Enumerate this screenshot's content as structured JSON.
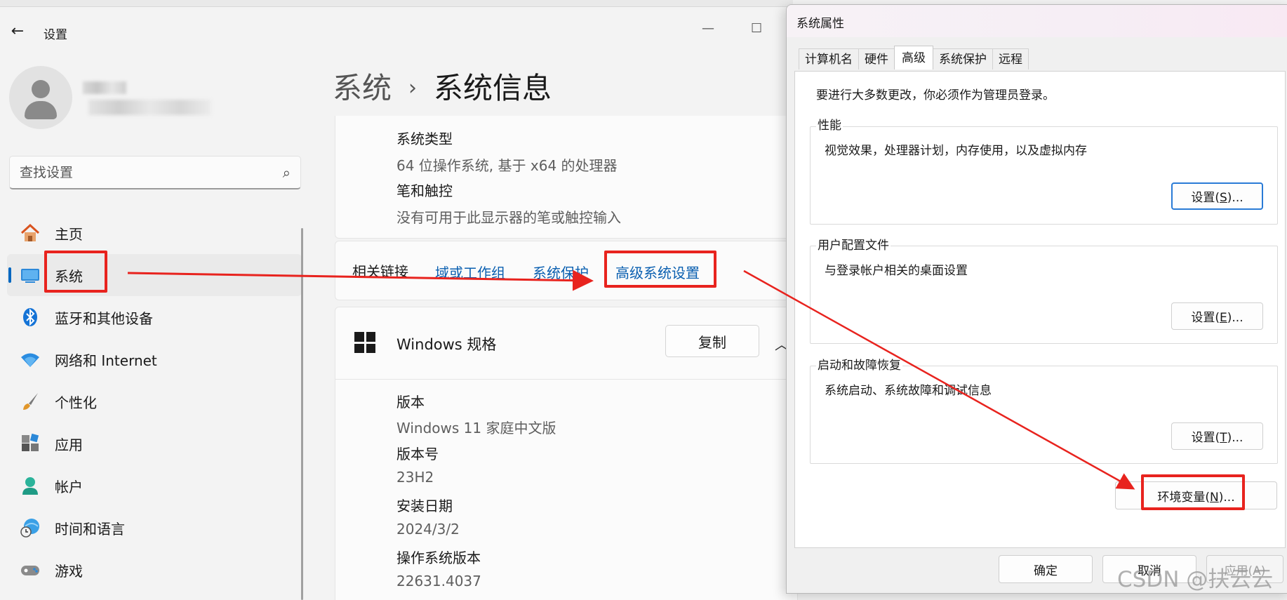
{
  "settings": {
    "app_title": "设置",
    "search_placeholder": "查找设置",
    "nav": [
      {
        "label": "主页",
        "icon": "home-icon"
      },
      {
        "label": "系统",
        "icon": "monitor-icon"
      },
      {
        "label": "蓝牙和其他设备",
        "icon": "bluetooth-icon"
      },
      {
        "label": "网络和 Internet",
        "icon": "wifi-icon"
      },
      {
        "label": "个性化",
        "icon": "brush-icon"
      },
      {
        "label": "应用",
        "icon": "apps-icon"
      },
      {
        "label": "帐户",
        "icon": "account-icon"
      },
      {
        "label": "时间和语言",
        "icon": "globe-clock-icon"
      },
      {
        "label": "游戏",
        "icon": "gamepad-icon"
      }
    ],
    "active_nav": "系统",
    "breadcrumb": {
      "parent": "系统",
      "separator": "›",
      "current": "系统信息"
    },
    "device_rows": [
      {
        "label": "系统类型",
        "value": "64 位操作系统, 基于 x64 的处理器"
      },
      {
        "label": "笔和触控",
        "value": "没有可用于此显示器的笔或触控输入"
      }
    ],
    "related_links": {
      "title": "相关链接",
      "links": [
        "域或工作组",
        "系统保护",
        "高级系统设置"
      ]
    },
    "windows_spec": {
      "title": "Windows 规格",
      "copy_button": "复制",
      "rows": [
        {
          "label": "版本",
          "value": "Windows 11 家庭中文版"
        },
        {
          "label": "版本号",
          "value": "23H2"
        },
        {
          "label": "安装日期",
          "value": "2024/3/2"
        },
        {
          "label": "操作系统版本",
          "value": "22631.4037"
        }
      ]
    }
  },
  "dialog": {
    "title": "系统属性",
    "tabs": [
      "计算机名",
      "硬件",
      "高级",
      "系统保护",
      "远程"
    ],
    "active_tab": "高级",
    "intro": "要进行大多数更改，你必须作为管理员登录。",
    "groups": [
      {
        "title": "性能",
        "desc": "视觉效果，处理器计划，内存使用，以及虚拟内存",
        "button_prefix": "设置(",
        "button_key": "S",
        "button_suffix": ")..."
      },
      {
        "title": "用户配置文件",
        "desc": "与登录帐户相关的桌面设置",
        "button_prefix": "设置(",
        "button_key": "E",
        "button_suffix": ")..."
      },
      {
        "title": "启动和故障恢复",
        "desc": "系统启动、系统故障和调试信息",
        "button_prefix": "设置(",
        "button_key": "T",
        "button_suffix": ")..."
      }
    ],
    "env_button": {
      "prefix": "环境变量(",
      "key": "N",
      "suffix": ")..."
    },
    "footer": {
      "ok": "确定",
      "cancel": "取消",
      "apply": "应用(A)"
    }
  },
  "annotations": {
    "highlight_color": "#e8231e"
  },
  "watermark": "CSDN @扶云云",
  "colors": {
    "accent": "#0067c0",
    "link": "#0a5fb0",
    "annotation": "#e8231e"
  }
}
